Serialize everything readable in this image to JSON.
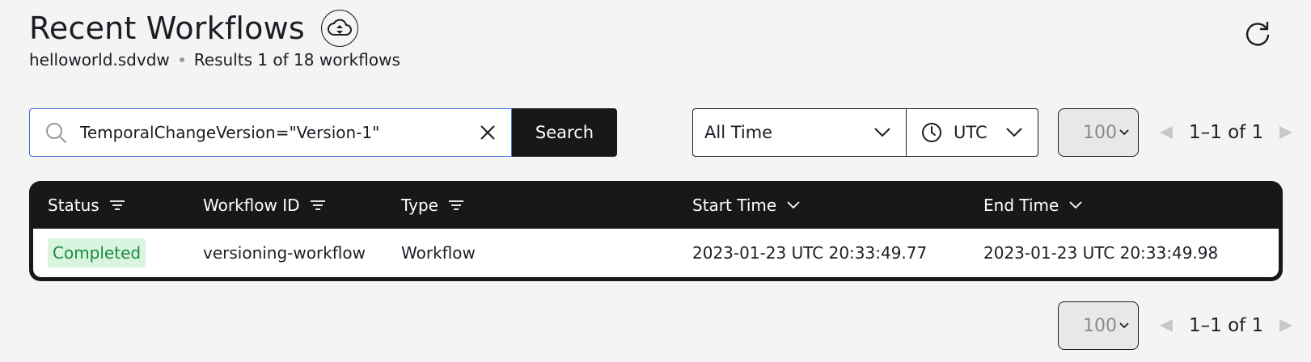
{
  "header": {
    "title": "Recent Workflows",
    "namespace": "helloworld.sdvdw",
    "results": "Results 1 of 18 workflows"
  },
  "search": {
    "query": "TemporalChangeVersion=\"Version-1\"",
    "button_label": "Search"
  },
  "filters": {
    "time_range": "All Time",
    "timezone": "UTC"
  },
  "pagination": {
    "per_page": "100",
    "range": "1–1 of 1"
  },
  "table": {
    "columns": [
      "Status",
      "Workflow ID",
      "Type",
      "Start Time",
      "End Time"
    ],
    "rows": [
      {
        "status": "Completed",
        "workflow_id": "versioning-workflow",
        "type": "Workflow",
        "start_time": "2023-01-23 UTC 20:33:49.77",
        "end_time": "2023-01-23 UTC 20:33:49.98"
      }
    ]
  },
  "colors": {
    "accent": "#3b6fd8",
    "dark": "#18181b",
    "success_bg": "#d9f5e0",
    "success_text": "#1a8a3e"
  },
  "icons": {
    "cloud": "cloud-upload-download-icon",
    "refresh": "refresh-icon",
    "search": "search-icon",
    "clear": "close-icon",
    "clock": "clock-icon",
    "filter": "filter-icon",
    "sort": "chevron-down-icon"
  }
}
